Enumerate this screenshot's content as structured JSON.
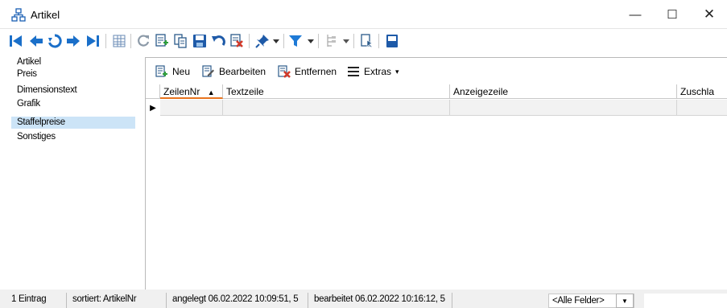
{
  "window": {
    "title": "Artikel",
    "controls": {
      "minimize": "—",
      "maximize": "☐",
      "close": "✕"
    }
  },
  "toolbar": {
    "buttons": [
      "first-record-icon",
      "previous-record-icon",
      "reload-icon",
      "next-record-icon",
      "last-record-icon",
      "table-view-icon",
      "refresh-icon",
      "new-record-icon",
      "copy-icon",
      "save-icon",
      "undo-icon",
      "delete-icon",
      "pin-icon",
      "filter-icon",
      "tree-icon",
      "export-icon",
      "layout-icon"
    ],
    "colors": {
      "nav_blue": "#1a6fc9",
      "green": "#2e9e3a",
      "red": "#d23a2a",
      "filter_blue": "#1e7ad6"
    }
  },
  "sidebar": {
    "items": [
      {
        "label": "Artikel",
        "selected": false
      },
      {
        "label": "Preis",
        "selected": false
      },
      {
        "label": "Dimensionstext",
        "selected": false
      },
      {
        "label": "Grafik",
        "selected": false
      },
      {
        "label": "Staffelpreise",
        "selected": true
      },
      {
        "label": "Sonstiges",
        "selected": false
      }
    ]
  },
  "subtoolbar": {
    "new_label": "Neu",
    "edit_label": "Bearbeiten",
    "remove_label": "Entfernen",
    "extras_label": "Extras",
    "extras_arrow": "▾"
  },
  "grid": {
    "columns": [
      "ZeilenNr",
      "Textzeile",
      "Anzeigezeile",
      "Zuschla"
    ],
    "sorted_column": "ZeilenNr",
    "sort_indicator": "▲",
    "row_indicator": "▶",
    "rows": [
      [
        "",
        "",
        "",
        ""
      ]
    ]
  },
  "statusbar": {
    "count": "1 Eintrag",
    "sorted": "sortiert: ArtikelNr",
    "created": "angelegt 06.02.2022 10:09:51, 5",
    "edited": "bearbeitet 06.02.2022 10:16:12, 5",
    "field_select": "<Alle Felder>",
    "field_select_arrow": "▼",
    "search_value": ""
  }
}
